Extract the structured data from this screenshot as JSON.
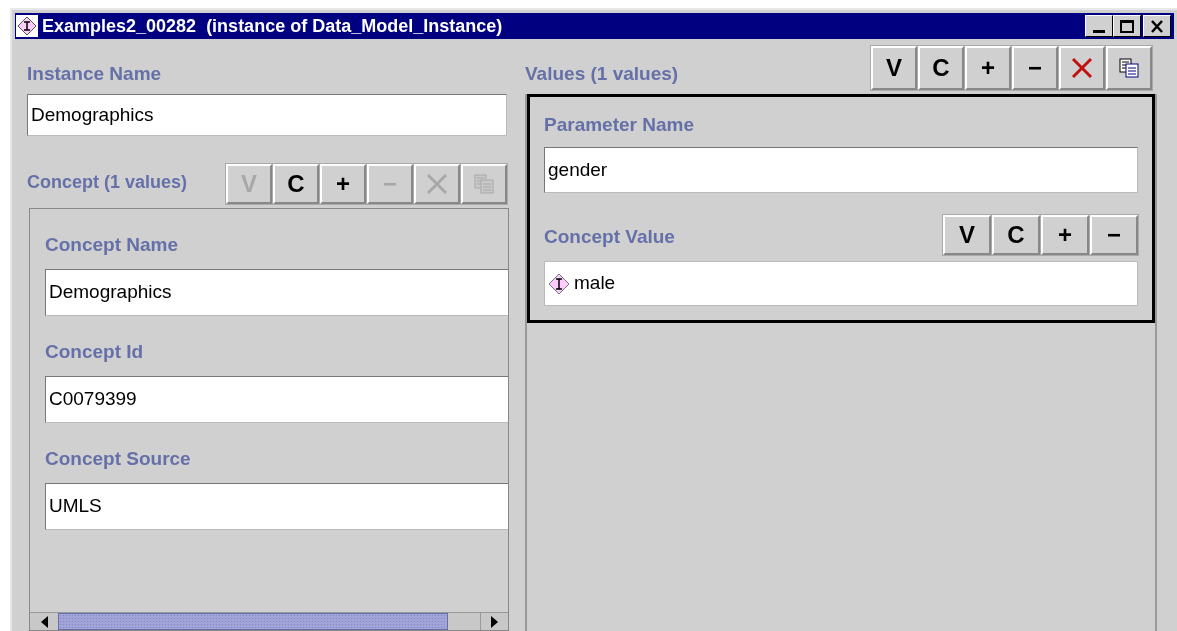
{
  "window": {
    "title": "Examples2_00282  (instance of Data_Model_Instance)"
  },
  "instance_name": {
    "label": "Instance Name",
    "value": "Demographics"
  },
  "concept": {
    "label": "Concept (1 values)",
    "buttons": [
      {
        "kind": "text",
        "label": "V",
        "disabled": true
      },
      {
        "kind": "text",
        "label": "C",
        "disabled": false
      },
      {
        "kind": "text",
        "label": "+",
        "disabled": false
      },
      {
        "kind": "text",
        "label": "−",
        "disabled": true
      },
      {
        "kind": "delete",
        "disabled": true
      },
      {
        "kind": "copy",
        "disabled": true
      }
    ],
    "fields": [
      {
        "label": "Concept Name",
        "value": "Demographics"
      },
      {
        "label": "Concept Id",
        "value": "C0079399"
      },
      {
        "label": "Concept Source",
        "value": "UMLS"
      }
    ]
  },
  "values": {
    "label": "Values (1 values)",
    "buttons": [
      {
        "kind": "text",
        "label": "V",
        "disabled": false
      },
      {
        "kind": "text",
        "label": "C",
        "disabled": false
      },
      {
        "kind": "text",
        "label": "+",
        "disabled": false
      },
      {
        "kind": "text",
        "label": "−",
        "disabled": false
      },
      {
        "kind": "delete",
        "disabled": false
      },
      {
        "kind": "copy",
        "disabled": false
      }
    ],
    "parameter_name": {
      "label": "Parameter Name",
      "value": "gender"
    },
    "concept_value": {
      "label": "Concept Value",
      "buttons": [
        {
          "kind": "text",
          "label": "V",
          "disabled": false
        },
        {
          "kind": "text",
          "label": "C",
          "disabled": false
        },
        {
          "kind": "text",
          "label": "+",
          "disabled": false
        },
        {
          "kind": "text",
          "label": "−",
          "disabled": false
        }
      ],
      "items": [
        {
          "label": "male"
        }
      ]
    }
  }
}
